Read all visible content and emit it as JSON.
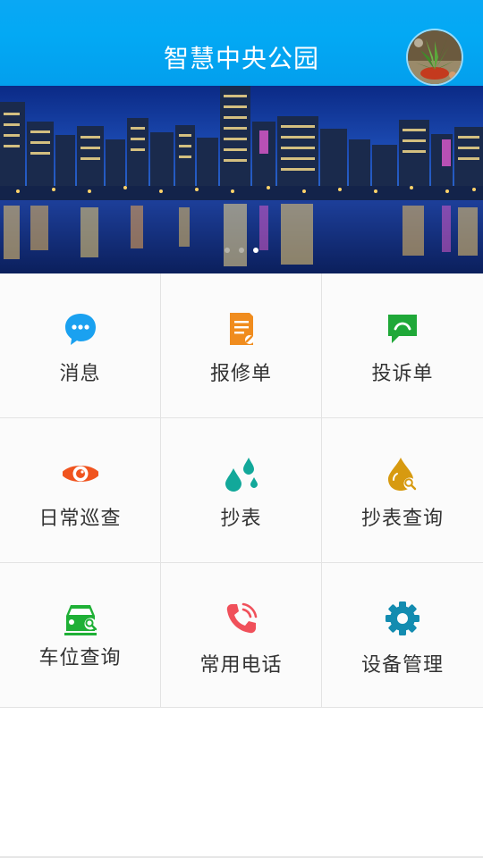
{
  "header": {
    "title": "智慧中央公园",
    "background_color": "#03a9f4",
    "avatar_icon": "plant-photo-avatar"
  },
  "banner": {
    "image": "city-night-skyline-photo",
    "slide_count": 3,
    "active_slide": 3
  },
  "menu": {
    "items": [
      {
        "label": "消息",
        "icon": "chat-bubble-icon",
        "color": "#1aa1f0"
      },
      {
        "label": "报修单",
        "icon": "repair-doc-icon",
        "color": "#f08c1e"
      },
      {
        "label": "投诉单",
        "icon": "complaint-chat-icon",
        "color": "#1fa838"
      },
      {
        "label": "日常巡查",
        "icon": "eye-icon",
        "color": "#f0541f"
      },
      {
        "label": "抄表",
        "icon": "water-drops-icon",
        "color": "#12a89a"
      },
      {
        "label": "抄表查询",
        "icon": "drop-search-icon",
        "color": "#d79a10"
      },
      {
        "label": "车位查询",
        "icon": "car-search-icon",
        "color": "#1fb036"
      },
      {
        "label": "常用电话",
        "icon": "phone-icon",
        "color": "#f0505a"
      },
      {
        "label": "设备管理",
        "icon": "gear-icon",
        "color": "#138cb0"
      }
    ]
  }
}
